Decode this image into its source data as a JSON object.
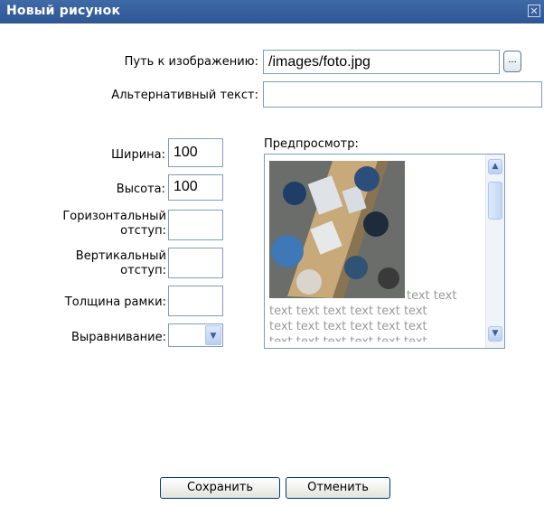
{
  "dialog": {
    "title": "Новый рисунок",
    "close_icon": "close-icon"
  },
  "form": {
    "path_label": "Путь к изображению:",
    "path_value": "/images/foto.jpg",
    "browse_label": "...",
    "alt_label": "Альтернативный текст:",
    "alt_value": "",
    "width_label": "Ширина:",
    "width_value": "100",
    "height_label": "Высота:",
    "height_value": "100",
    "hspace_label_1": "Горизонтальный",
    "hspace_label_2": "отступ:",
    "hspace_value": "",
    "vspace_label_1": "Вертикальный",
    "vspace_label_2": "отступ:",
    "vspace_value": "",
    "border_label": "Толщина рамки:",
    "border_value": "",
    "align_label": "Выравнивание:",
    "align_value": ""
  },
  "preview": {
    "label": "Предпросмотр:",
    "text_line_1": "text text",
    "text_line_2": "text text text text text text",
    "text_line_3": "text text text text text text",
    "text_line_4": "text text text text text text"
  },
  "buttons": {
    "save": "Сохранить",
    "cancel": "Отменить"
  }
}
